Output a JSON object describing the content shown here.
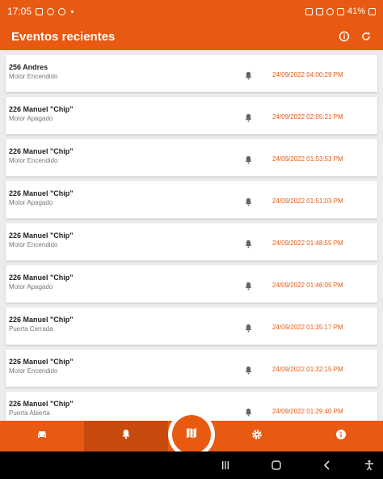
{
  "status_bar": {
    "time": "17:05",
    "battery": "41%"
  },
  "app_bar": {
    "title": "Eventos recientes",
    "info_icon": "info-circle-icon",
    "refresh_icon": "refresh-icon"
  },
  "events": [
    {
      "name": "256 Andres",
      "event": "Motor Encendido",
      "timestamp": "24/09/2022 04:00:29 PM"
    },
    {
      "name": "226 Manuel \"Chip\"",
      "event": "Motor Apagado",
      "timestamp": "24/09/2022 02:05:21 PM"
    },
    {
      "name": "226 Manuel \"Chip\"",
      "event": "Motor Encendido",
      "timestamp": "24/09/2022 01:53:53 PM"
    },
    {
      "name": "226 Manuel \"Chip\"",
      "event": "Motor Apagado",
      "timestamp": "24/09/2022 01:51:03 PM"
    },
    {
      "name": "226 Manuel \"Chip\"",
      "event": "Motor Encendido",
      "timestamp": "24/09/2022 01:48:55 PM"
    },
    {
      "name": "226 Manuel \"Chip\"",
      "event": "Motor Apagado",
      "timestamp": "24/09/2022 01:46:05 PM"
    },
    {
      "name": "226 Manuel \"Chip\"",
      "event": "Puerta Cerrada",
      "timestamp": "24/09/2022 01:35:17 PM"
    },
    {
      "name": "226 Manuel \"Chip\"",
      "event": "Motor Encendido",
      "timestamp": "24/09/2022 01:32:15 PM"
    },
    {
      "name": "226 Manuel \"Chip\"",
      "event": "Puerta Abierta",
      "timestamp": "24/09/2022 01:29:40 PM"
    }
  ],
  "bottom_nav": {
    "tabs": [
      "car-icon",
      "bell-icon",
      "map-icon",
      "gear-icon",
      "info-icon"
    ],
    "active": "bell-icon"
  },
  "colors": {
    "accent": "#e85a12",
    "accent_dark": "#c84a0e",
    "list_background": "#ececec"
  }
}
